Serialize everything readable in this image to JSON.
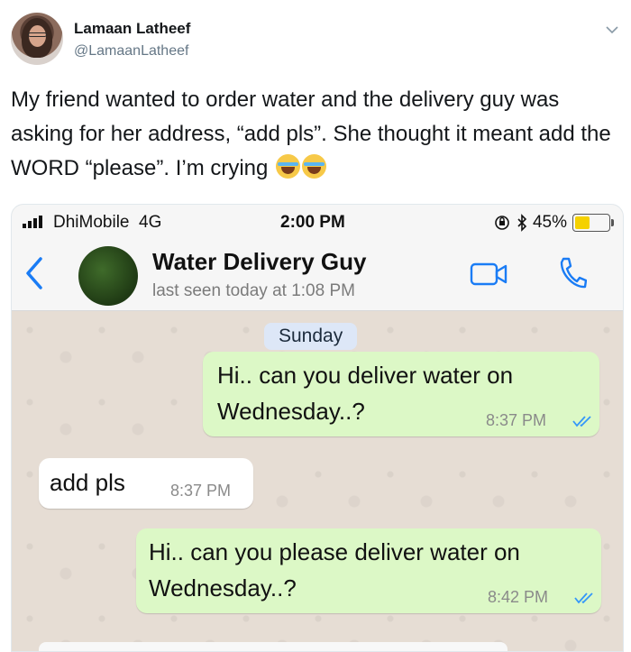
{
  "tweet": {
    "author_name": "Lamaan Latheef",
    "author_handle": "@LamaanLatheef",
    "text": "My friend wanted to order water and the delivery guy was asking for her address, “add pls”. She thought it meant add the WORD “please”. I’m crying",
    "emojis": [
      "face-with-tears-of-joy",
      "face-with-tears-of-joy"
    ],
    "menu_icon": "chevron-down-icon"
  },
  "phone": {
    "status_bar": {
      "carrier": "DhiMobile",
      "network": "4G",
      "time": "2:00 PM",
      "battery": "45%",
      "battery_level": 0.45,
      "battery_color": "#f5d100"
    },
    "chat_header": {
      "contact_name": "Water Delivery Guy",
      "last_seen": "last seen today at 1:08 PM",
      "accent_color": "#1a7cf5"
    },
    "chat": {
      "date_label": "Sunday",
      "messages": [
        {
          "direction": "outgoing",
          "text_line1": "Hi.. can you deliver water on",
          "text_line2": "Wednesday..?",
          "time": "8:37 PM",
          "status": "read"
        },
        {
          "direction": "incoming",
          "text": "add pls",
          "time": "8:37 PM"
        },
        {
          "direction": "outgoing",
          "text_line1": "Hi.. can you please deliver water on",
          "text_line2": "Wednesday..?",
          "time": "8:42 PM",
          "status": "read"
        }
      ],
      "outgoing_bubble_color": "#dcf8c6",
      "incoming_bubble_color": "#ffffff"
    }
  }
}
